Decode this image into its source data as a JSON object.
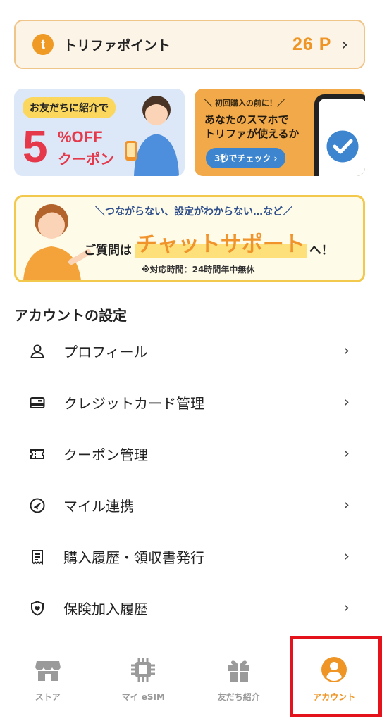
{
  "points": {
    "logo_letter": "t",
    "label": "トリファポイント",
    "value": "26 P"
  },
  "banners": {
    "invite": {
      "tag": "お友だちに紹介で",
      "percent": "5",
      "off": "%OFF",
      "coupon": "クーポン"
    },
    "check": {
      "subtitle": "＼ 初回購入の前に！／",
      "title_line1": "あなたのスマホで",
      "title_line2": "トリファが使えるか",
      "button": "3秒でチェック ›"
    },
    "support": {
      "top": "＼つながらない、設定がわからない…など／",
      "pre": "ご質問は",
      "highlight": "チャットサポート",
      "post": "へ！",
      "hours": "※対応時間：24時間年中無休"
    }
  },
  "settings": {
    "title": "アカウントの設定",
    "items": [
      {
        "label": "プロフィール",
        "icon": "person-icon"
      },
      {
        "label": "クレジットカード管理",
        "icon": "credit-card-icon"
      },
      {
        "label": "クーポン管理",
        "icon": "ticket-icon"
      },
      {
        "label": "マイル連携",
        "icon": "plane-icon"
      },
      {
        "label": "購入履歴・領収書発行",
        "icon": "receipt-icon"
      },
      {
        "label": "保険加入履歴",
        "icon": "shield-icon"
      }
    ]
  },
  "tabbar": {
    "tabs": [
      {
        "label": "ストア",
        "icon": "store-icon"
      },
      {
        "label": "マイ eSIM",
        "icon": "chip-icon"
      },
      {
        "label": "友だち紹介",
        "icon": "gift-icon"
      },
      {
        "label": "アカウント",
        "icon": "account-icon"
      }
    ],
    "active_index": 3
  },
  "colors": {
    "accent": "#ee9525",
    "highlight_box": "#e4121a"
  }
}
